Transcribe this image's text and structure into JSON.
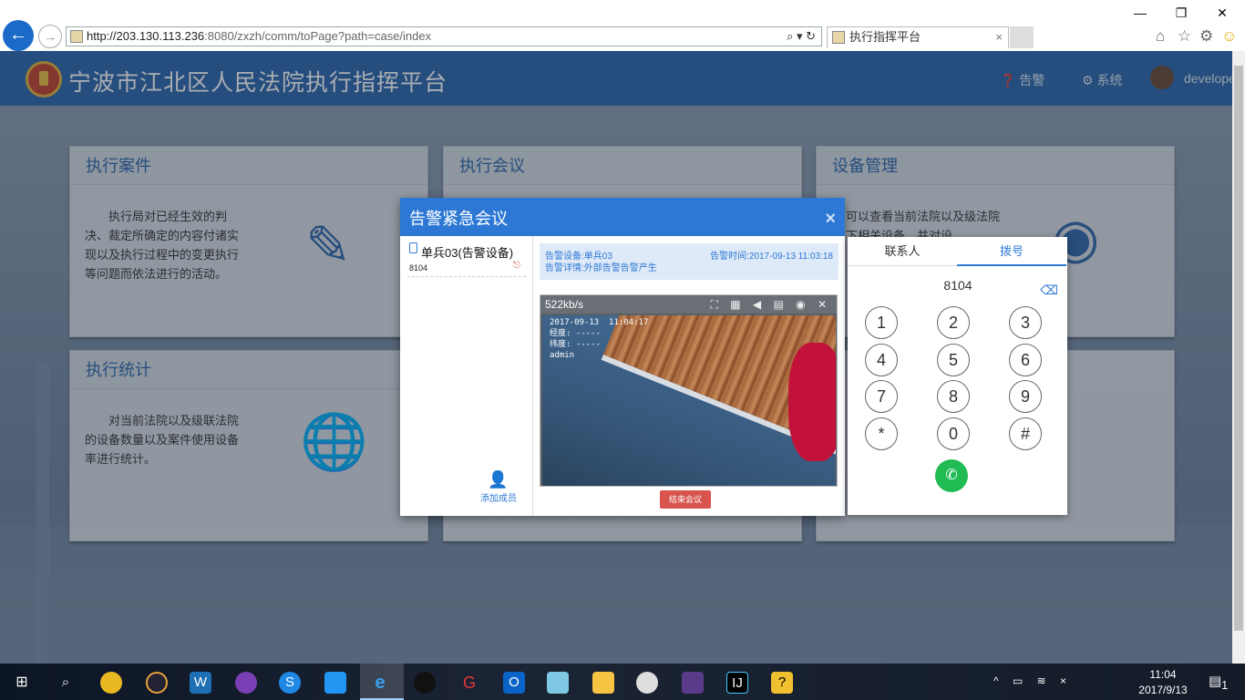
{
  "browser": {
    "url_host": "http://203.130.113.236",
    "url_rest": ":8080/zxzh/comm/toPage?path=case/index",
    "tab_title": "执行指挥平台",
    "tab_close": "×",
    "window_controls": [
      "—",
      "❐",
      "✕"
    ],
    "address_icons": "⌕ ▾ ↻",
    "toolbar_icons": [
      "⌂",
      "☆",
      "⚙",
      "☺"
    ]
  },
  "header": {
    "title": "宁波市江北区人民法院执行指挥平台",
    "alarm_label": "告警",
    "system_label": "系统",
    "user_name": "developer",
    "accent_color": "#2b64a8"
  },
  "cards": [
    {
      "title": "执行案件",
      "text": "执行局对已经生效的判决、裁定所确定的内容付诸实现以及执行过程中的变更执行等问题而依法进行的活动。",
      "icon": "document-edit-icon"
    },
    {
      "title": "执行会议",
      "text": "",
      "icon": ""
    },
    {
      "title": "设备管理",
      "text": "可以查看当前法院以及级法院下相关设备，并对设",
      "icon": "user-broadcast-icon"
    },
    {
      "title": "执行统计",
      "text": "对当前法院以及级联法院的设备数量以及案件使用设备率进行统计。",
      "icon": "globe-location-icon"
    }
  ],
  "modal": {
    "title": "告警紧急会议",
    "close": "×",
    "member": {
      "name": "单兵03(告警设备)",
      "id": "8104"
    },
    "add_member": "添加成员",
    "alarm_device": "告警设备:单兵03",
    "alarm_time": "告警时间:2017-09-13 11:03:18",
    "alarm_detail": "告警详情:外部告警告警产生",
    "video_bitrate": "522kb/s",
    "video_tools": "⛶ ▦ ◀ ▤ ◉ ✕",
    "osd": "2017-09-13  11:04:17\n经度: -----\n纬度: -----\nadmin",
    "end_meeting": "结束会议"
  },
  "dialer": {
    "tab_contacts": "联系人",
    "tab_dial": "拨号",
    "display": "8104",
    "keys": [
      "1",
      "2",
      "3",
      "4",
      "5",
      "6",
      "7",
      "8",
      "9",
      "*",
      "0",
      "#"
    ],
    "call_color": "#21bb54"
  },
  "taskbar": {
    "time": "11:04",
    "date": "2017/9/13",
    "notifications": "1"
  }
}
